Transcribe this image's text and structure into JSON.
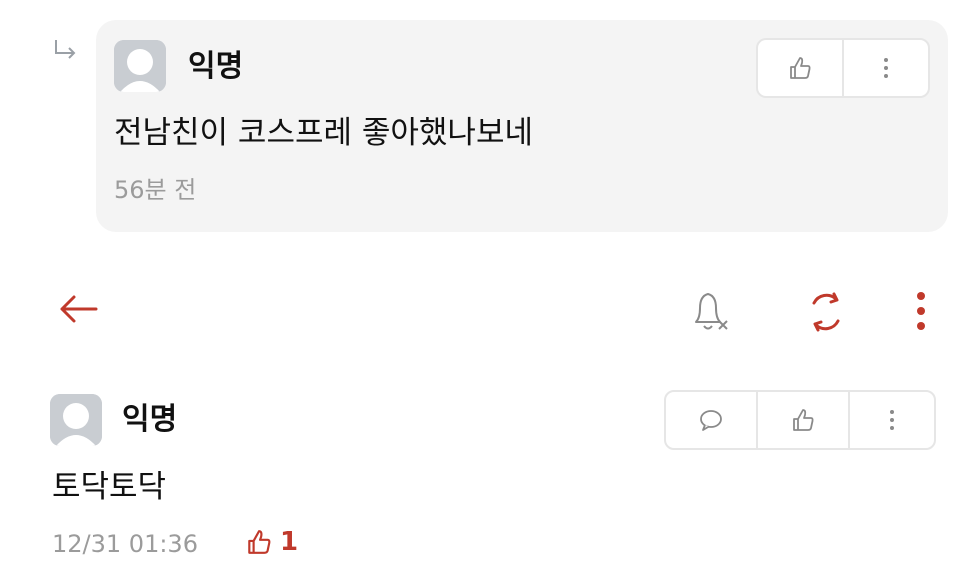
{
  "reply": {
    "nickname": "익명",
    "text": "전남친이 코스프레 좋아했나보네",
    "time": "56분 전"
  },
  "toolbar": {
    "back_icon": "arrow-left-icon",
    "notify_icon": "bell-off-icon",
    "refresh_icon": "refresh-icon",
    "more_icon": "more-vertical-icon",
    "accent_color": "#c0392b"
  },
  "post": {
    "nickname": "익명",
    "text": "토닥토닥",
    "time": "12/31 01:36",
    "like_count": "1"
  }
}
